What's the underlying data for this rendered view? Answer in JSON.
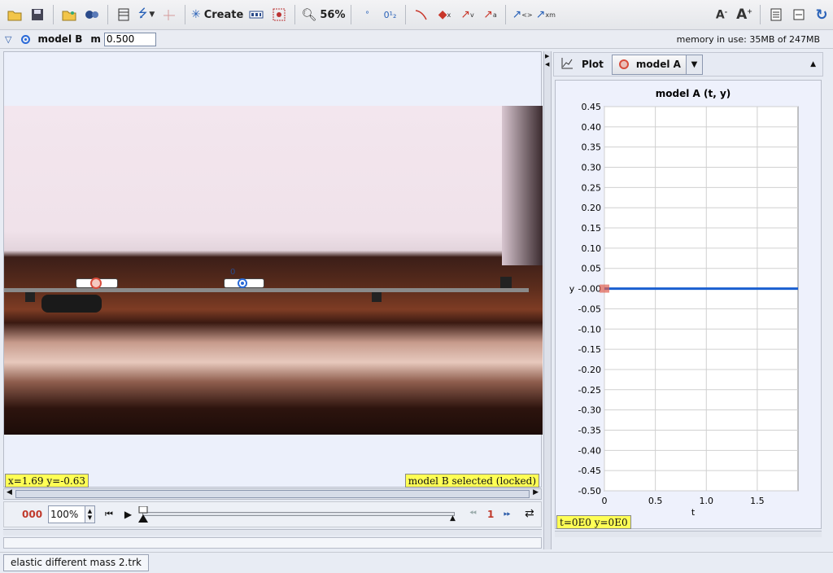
{
  "toolbar": {
    "create_label": "Create",
    "zoom_label": "56%"
  },
  "trackbar": {
    "track_name": "model B",
    "mass_label": "m",
    "mass_value": "0.500",
    "memory_text": "memory in use: 35MB of 247MB"
  },
  "video": {
    "label_b": "0",
    "coords_readout": "x=1.69  y=-0.63",
    "selection_status": "model B selected (locked)"
  },
  "player": {
    "frame_number": "000",
    "rate": "100%",
    "step_size": "1"
  },
  "plot": {
    "tab_label": "Plot",
    "selected_track": "model A",
    "readout": "t=0E0  y=0E0"
  },
  "chart_data": {
    "type": "line",
    "title": "model A (t, y)",
    "xlabel": "t",
    "ylabel": "y",
    "xlim": [
      0,
      1.9
    ],
    "ylim": [
      -0.5,
      0.45
    ],
    "xticks": [
      "0",
      "0.5",
      "1.0",
      "1.5"
    ],
    "yticks": [
      "0.45",
      "0.40",
      "0.35",
      "0.30",
      "0.25",
      "0.20",
      "0.15",
      "0.10",
      "0.05",
      "-0.00",
      "-0.05",
      "-0.10",
      "-0.15",
      "-0.20",
      "-0.25",
      "-0.30",
      "-0.35",
      "-0.40",
      "-0.45",
      "-0.50"
    ],
    "grid": true,
    "series": [
      {
        "x": [
          0,
          1.9
        ],
        "y": [
          0,
          0
        ],
        "color": "#1a5fd0"
      }
    ],
    "marker_point": {
      "x": 0,
      "y": 0,
      "color": "#e06050"
    }
  },
  "bottom": {
    "file_tab": "elastic different mass 2.trk"
  }
}
